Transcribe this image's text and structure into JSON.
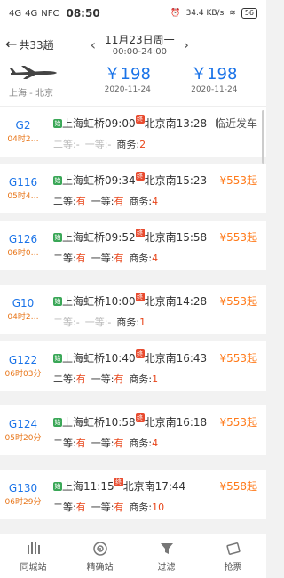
{
  "status": {
    "signal1": "4G",
    "signal2": "4G",
    "nfc": "NFC",
    "time": "08:50",
    "speed": "34.4 KB/s",
    "battery": "56"
  },
  "header": {
    "back_label": "共33趟",
    "date": "11月23日周一",
    "time_range": "00:00-24:00"
  },
  "flight": {
    "route": "上海 - 北京",
    "prices": [
      {
        "price": "￥198",
        "date": "2020-11-24"
      },
      {
        "price": "￥198",
        "date": "2020-11-24"
      }
    ]
  },
  "trains": [
    {
      "no": "G2",
      "dur": "04时2…",
      "dep": "上海虹桥09:00",
      "arr": "北京南13:28",
      "right": "临近发车",
      "right_type": "near",
      "seats": [
        {
          "label": "二等:",
          "val": "-"
        },
        {
          "label": "一等:",
          "val": "-"
        },
        {
          "label": "商务:",
          "val": "2"
        }
      ],
      "muted": true
    },
    {
      "no": "G116",
      "dur": "05时4…",
      "dep": "上海虹桥09:34",
      "arr": "北京南15:23",
      "right": "¥553起",
      "right_type": "price",
      "seats": [
        {
          "label": "二等:",
          "val": "有"
        },
        {
          "label": "一等:",
          "val": "有"
        },
        {
          "label": "商务:",
          "val": "4"
        }
      ],
      "muted": false
    },
    {
      "no": "G126",
      "dur": "06时0…",
      "dep": "上海虹桥09:52",
      "arr": "北京南15:58",
      "right": "¥553起",
      "right_type": "price",
      "seats": [
        {
          "label": "二等:",
          "val": "有"
        },
        {
          "label": "一等:",
          "val": "有"
        },
        {
          "label": "商务:",
          "val": "4"
        }
      ],
      "muted": false
    },
    {
      "no": "G10",
      "dur": "04时2…",
      "dep": "上海虹桥10:00",
      "arr": "北京南14:28",
      "right": "¥553起",
      "right_type": "price",
      "seats": [
        {
          "label": "二等:",
          "val": "-"
        },
        {
          "label": "一等:",
          "val": "-"
        },
        {
          "label": "商务:",
          "val": "1"
        }
      ],
      "muted": true
    },
    {
      "no": "G122",
      "dur": "06时03分",
      "dep": "上海虹桥10:40",
      "arr": "北京南16:43",
      "right": "¥553起",
      "right_type": "price",
      "seats": [
        {
          "label": "二等:",
          "val": "有"
        },
        {
          "label": "一等:",
          "val": "有"
        },
        {
          "label": "商务:",
          "val": "1"
        }
      ],
      "muted": false
    },
    {
      "no": "G124",
      "dur": "05时20分",
      "dep": "上海虹桥10:58",
      "arr": "北京南16:18",
      "right": "¥553起",
      "right_type": "price",
      "seats": [
        {
          "label": "二等:",
          "val": "有"
        },
        {
          "label": "一等:",
          "val": "有"
        },
        {
          "label": "商务:",
          "val": "4"
        }
      ],
      "muted": false
    },
    {
      "no": "G130",
      "dur": "06时29分",
      "dep": "上海11:15",
      "arr": "北京南17:44",
      "right": "¥558起",
      "right_type": "price",
      "seats": [
        {
          "label": "二等:",
          "val": "有"
        },
        {
          "label": "一等:",
          "val": "有"
        },
        {
          "label": "商务:",
          "val": "10"
        }
      ],
      "muted": false
    }
  ],
  "badges": {
    "start": "始",
    "end": "终"
  },
  "tabs": [
    "同城站",
    "精确站",
    "过滤",
    "抢票"
  ],
  "colors": {
    "accent": "#1a73e8",
    "price": "#ff7a1a",
    "available": "#e8451a"
  }
}
